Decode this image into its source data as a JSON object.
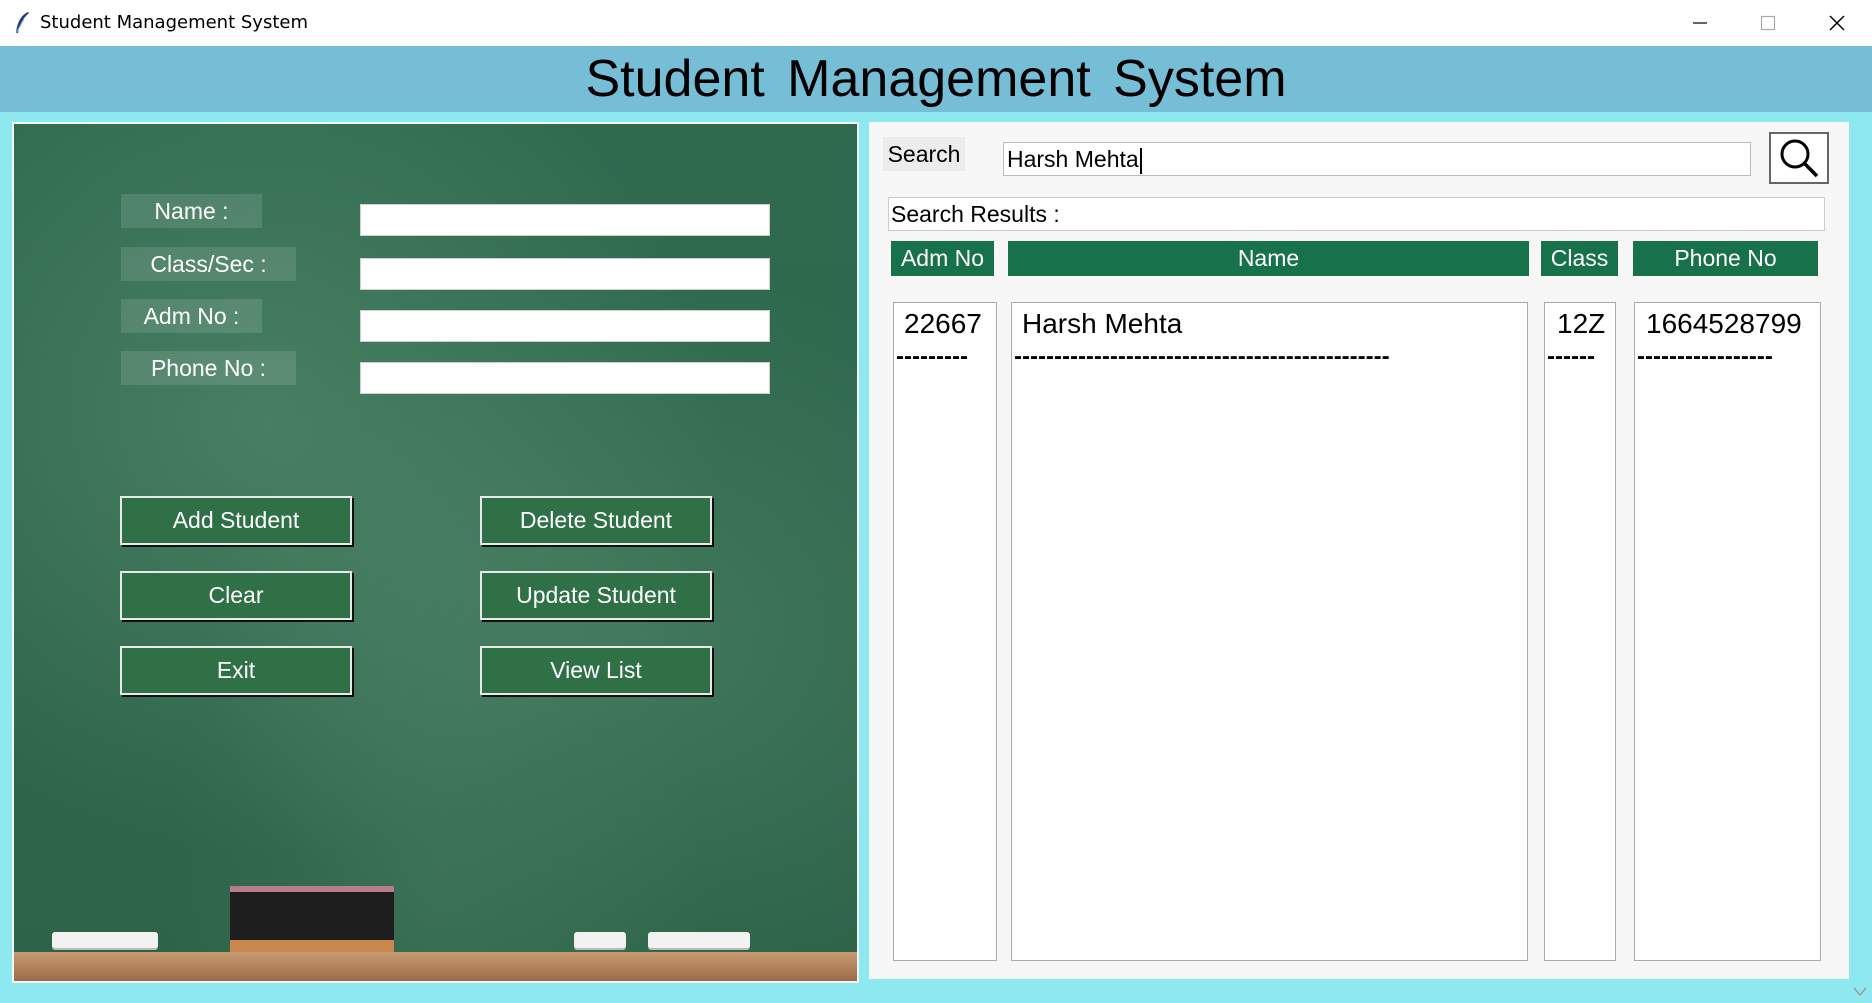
{
  "window": {
    "title": "Student Management System"
  },
  "header": {
    "title": "Student Management System"
  },
  "form": {
    "name_label": "Name :",
    "class_label": "Class/Sec :",
    "adm_label": "Adm No :",
    "phone_label": "Phone No :",
    "name_value": "",
    "class_value": "",
    "adm_value": "",
    "phone_value": ""
  },
  "buttons": {
    "add": "Add Student",
    "delete": "Delete Student",
    "clear": "Clear",
    "update": "Update Student",
    "exit": "Exit",
    "view": "View List"
  },
  "search": {
    "label": "Search",
    "value": "Harsh Mehta",
    "results_label": "Search Results :"
  },
  "table": {
    "headers": [
      "Adm No",
      "Name",
      "Class",
      "Phone No"
    ],
    "rows": [
      {
        "adm": "22667",
        "name": "Harsh Mehta",
        "class": "12Z",
        "phone": "1664528799"
      }
    ],
    "separators": {
      "adm": "---------",
      "name": "-----------------------------------------------",
      "class": "------",
      "phone": "-----------------"
    }
  },
  "colors": {
    "banner": "#76bdd6",
    "background": "#8ee8f0",
    "header_green": "#17724a",
    "button_green": "#2f7047"
  }
}
